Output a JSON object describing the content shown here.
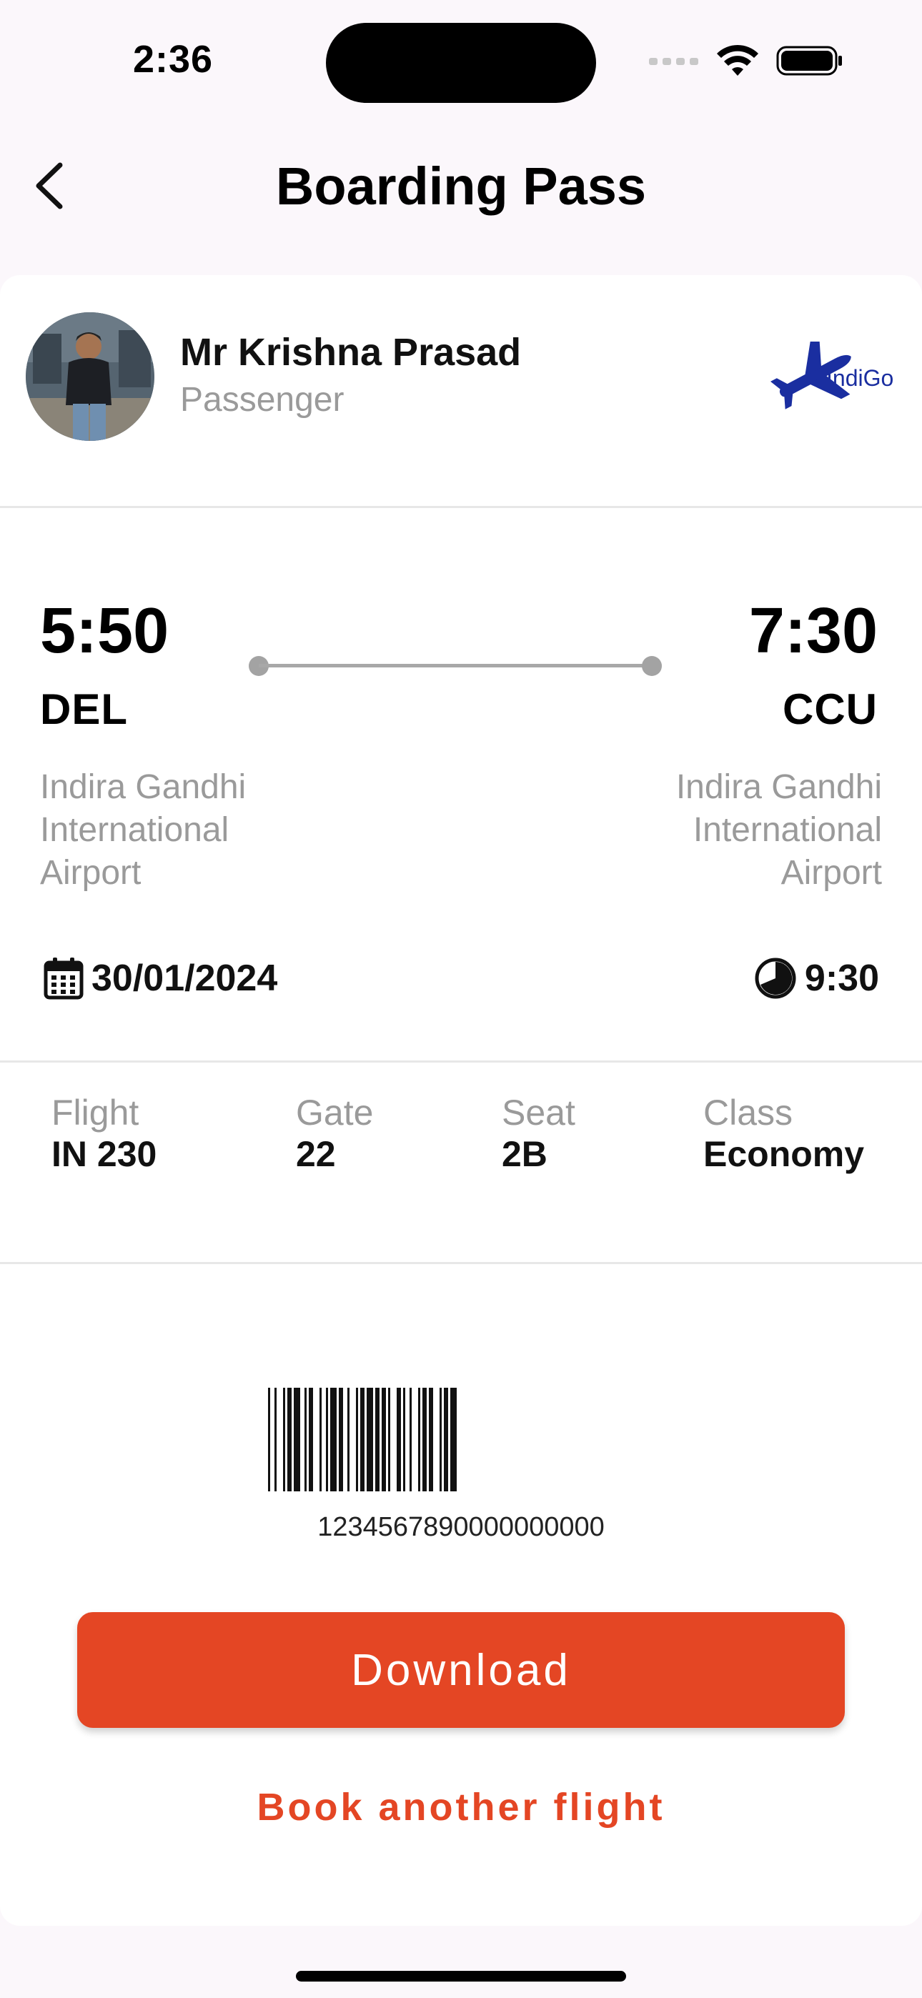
{
  "status_bar": {
    "time": "2:36"
  },
  "header": {
    "title": "Boarding Pass"
  },
  "passenger": {
    "name": "Mr Krishna Prasad",
    "role": "Passenger"
  },
  "airline": {
    "logo_text": "IndiGo",
    "brand_color": "#1a2ea0"
  },
  "departure": {
    "time": "5:50",
    "code": "DEL",
    "airport_lines": [
      "Indira Gandhi",
      "International",
      "Airport"
    ]
  },
  "arrival": {
    "time": "7:30",
    "code": "CCU",
    "airport_lines": [
      "Indira Gandhi",
      "International",
      "Airport"
    ]
  },
  "date": "30/01/2024",
  "duration": "9:30",
  "info": [
    {
      "label": "Flight",
      "value": "IN 230"
    },
    {
      "label": "Gate",
      "value": "22"
    },
    {
      "label": "Seat",
      "value": "2B"
    },
    {
      "label": "Class",
      "value": "Economy"
    }
  ],
  "barcode": {
    "number": "1234567890000000000"
  },
  "actions": {
    "download": "Download",
    "book_another": "Book another flight"
  },
  "colors": {
    "accent": "#e44624",
    "background": "#fbf7fb",
    "card": "#ffffff",
    "muted_text": "#9a9a9a"
  }
}
